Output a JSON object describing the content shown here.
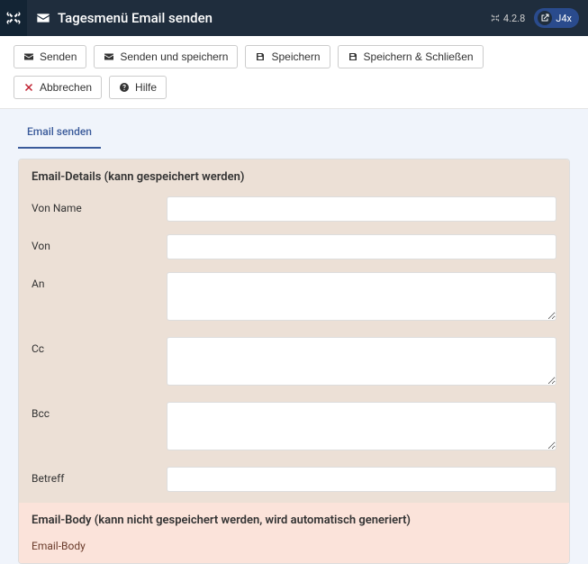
{
  "header": {
    "title": "Tagesmenü Email senden",
    "version": "4.2.8",
    "badge": "J4x"
  },
  "toolbar": {
    "send": "Senden",
    "send_save": "Senden und speichern",
    "save": "Speichern",
    "save_close": "Speichern & Schließen",
    "cancel": "Abbrechen",
    "help": "Hilfe"
  },
  "tabs": {
    "main": "Email senden"
  },
  "section_details": {
    "title": "Email-Details (kann gespeichert werden)",
    "fields": {
      "from_name": {
        "label": "Von Name",
        "value": ""
      },
      "from": {
        "label": "Von",
        "value": ""
      },
      "to": {
        "label": "An",
        "value": ""
      },
      "cc": {
        "label": "Cc",
        "value": ""
      },
      "bcc": {
        "label": "Bcc",
        "value": ""
      },
      "subject": {
        "label": "Betreff",
        "value": ""
      }
    }
  },
  "section_body": {
    "title": "Email-Body (kann nicht gespeichert werden, wird automatisch generiert)",
    "label": "Email-Body"
  }
}
